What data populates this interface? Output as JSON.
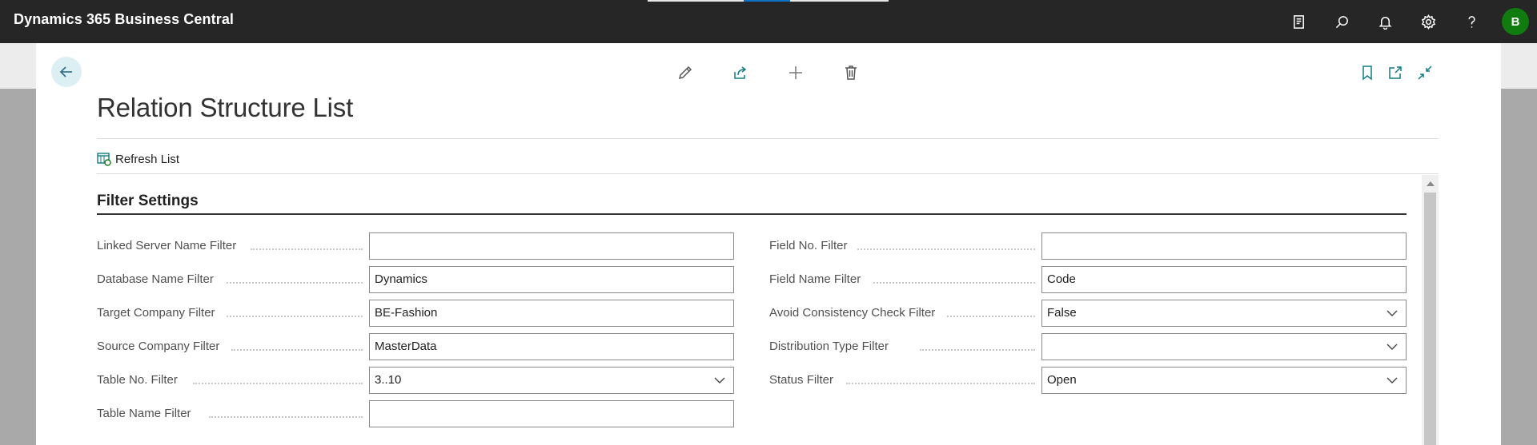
{
  "app": {
    "title": "Dynamics 365 Business Central",
    "user_initial": "B"
  },
  "top_icons": [
    "report-icon",
    "search-icon",
    "bell-icon",
    "gear-icon",
    "help-icon"
  ],
  "page": {
    "title": "Relation Structure List",
    "actions": [
      "edit-icon",
      "share-icon",
      "add-icon",
      "delete-icon"
    ],
    "right_actions": [
      "bookmark-icon",
      "open-new-window-icon",
      "collapse-icon"
    ],
    "refresh_label": "Refresh List"
  },
  "filter": {
    "section_title": "Filter Settings",
    "left": [
      {
        "label": "Linked Server Name Filter",
        "value": "",
        "dropdown": false
      },
      {
        "label": "Database Name Filter",
        "value": "Dynamics",
        "dropdown": false
      },
      {
        "label": "Target Company Filter",
        "value": "BE-Fashion",
        "dropdown": false
      },
      {
        "label": "Source Company Filter",
        "value": "MasterData",
        "dropdown": false
      },
      {
        "label": "Table No. Filter",
        "value": "3..10",
        "dropdown": true
      },
      {
        "label": "Table Name Filter",
        "value": "",
        "dropdown": false
      }
    ],
    "right": [
      {
        "label": "Field No. Filter",
        "value": "",
        "dropdown": false
      },
      {
        "label": "Field Name Filter",
        "value": "Code",
        "dropdown": false
      },
      {
        "label": "Avoid Consistency Check Filter",
        "value": "False",
        "dropdown": true
      },
      {
        "label": "Distribution Type Filter",
        "value": "",
        "dropdown": true
      },
      {
        "label": "Status Filter",
        "value": "Open",
        "dropdown": true
      }
    ]
  },
  "colors": {
    "topbar": "#262626",
    "accent": "#107c10",
    "link": "#0e7c86"
  }
}
